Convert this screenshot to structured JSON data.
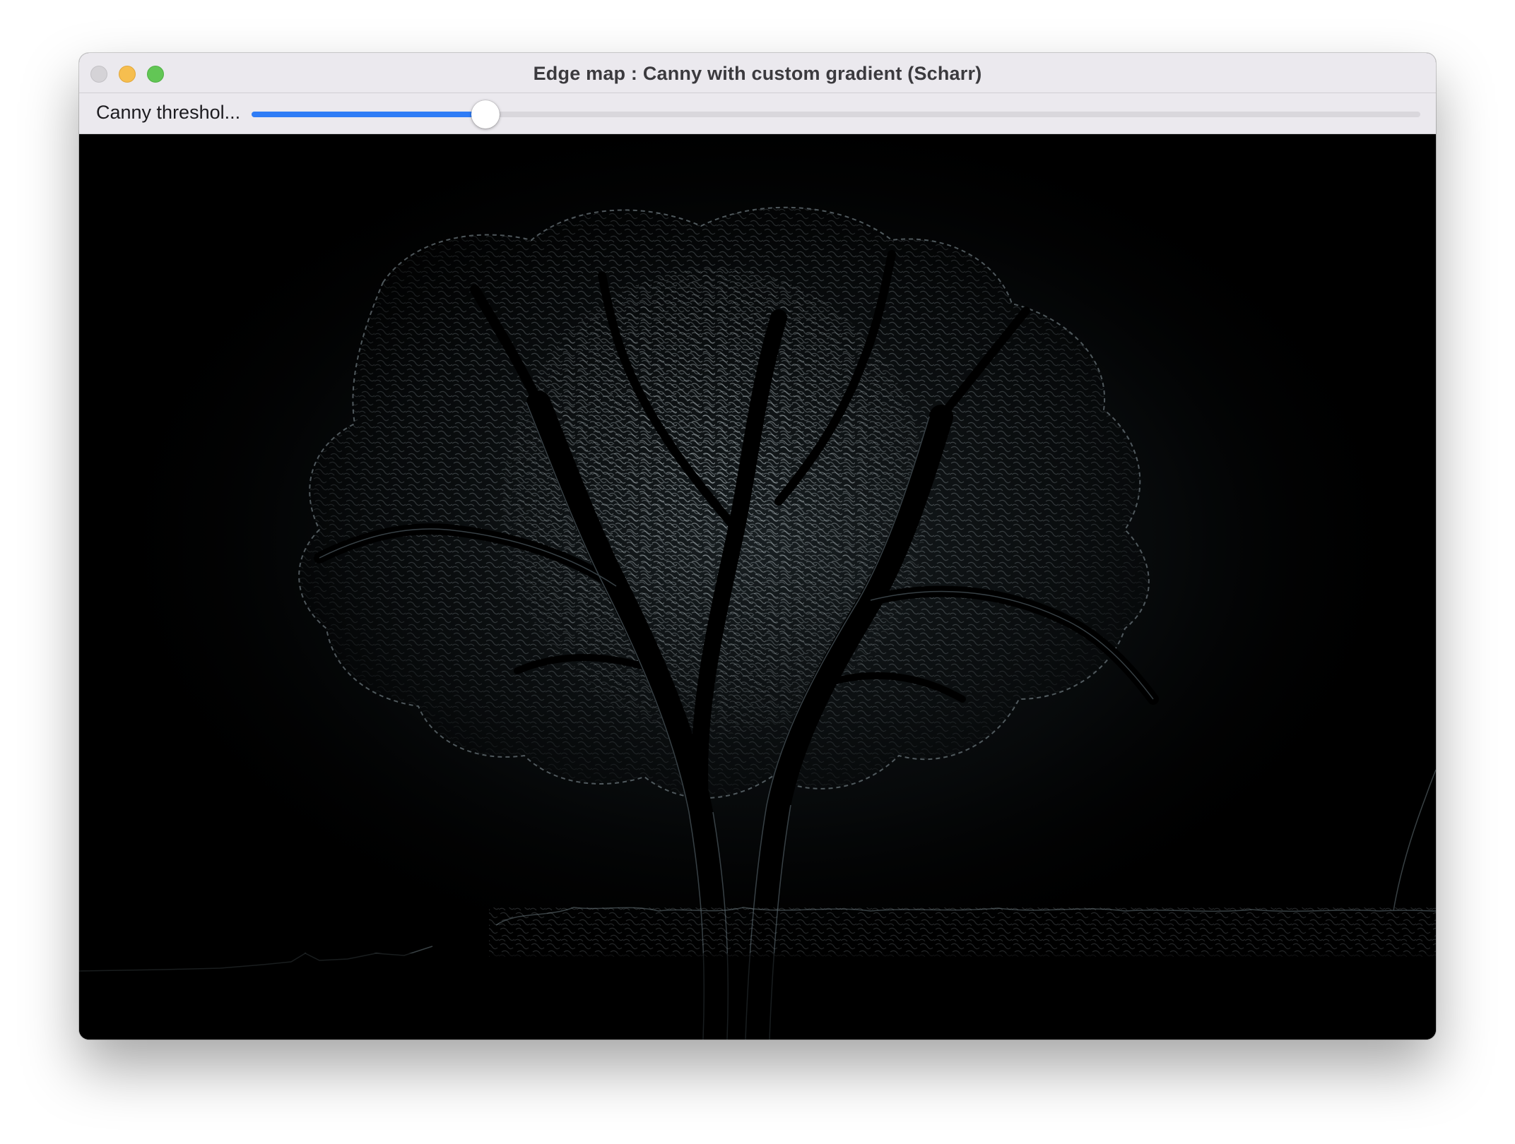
{
  "window": {
    "title": "Edge map : Canny with custom gradient (Scharr)"
  },
  "controls": {
    "threshold_slider": {
      "label": "Canny threshol...",
      "value_fraction": 0.2
    }
  },
  "image": {
    "description_icon": "edge-map-tree",
    "accent_color": "#9aa7ad"
  },
  "colors": {
    "slider_fill": "#2f7cf6",
    "close_button": "#d5d3d7",
    "minimize_button": "#f6be4f",
    "maximize_button": "#62c655"
  }
}
